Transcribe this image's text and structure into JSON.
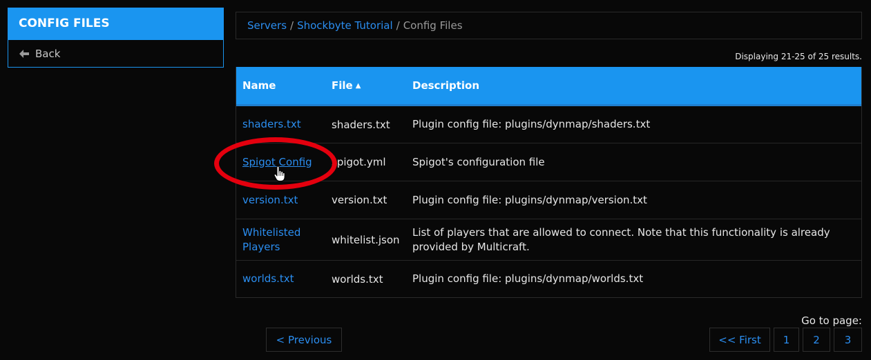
{
  "sidebar": {
    "title": "CONFIG FILES",
    "back_label": "Back"
  },
  "breadcrumb": {
    "items": [
      "Servers",
      "Shockbyte Tutorial"
    ],
    "current": "Config Files",
    "separator": "/"
  },
  "summary": "Displaying 21-25 of 25 results.",
  "table": {
    "headers": {
      "name": "Name",
      "file": "File",
      "description": "Description"
    },
    "sort_icon": "caret-up-icon",
    "rows": [
      {
        "name": "shaders.txt",
        "file": "shaders.txt",
        "description": "Plugin config file: plugins/dynmap/shaders.txt"
      },
      {
        "name": "Spigot Config",
        "file": "spigot.yml",
        "description": "Spigot's configuration file"
      },
      {
        "name": "version.txt",
        "file": "version.txt",
        "description": "Plugin config file: plugins/dynmap/version.txt"
      },
      {
        "name": "Whitelisted Players",
        "file": "whitelist.json",
        "description": "List of players that are allowed to connect. Note that this functionality is already provided by Multicraft."
      },
      {
        "name": "worlds.txt",
        "file": "worlds.txt",
        "description": "Plugin config file: plugins/dynmap/worlds.txt"
      }
    ]
  },
  "pagination": {
    "goto_label": "Go to page:",
    "previous": "< Previous",
    "first": "<< First",
    "pages": [
      "1",
      "2",
      "3"
    ]
  },
  "colors": {
    "accent": "#1a95f0",
    "link": "#2b8ef0",
    "highlight": "#e4000e",
    "background": "#080808"
  }
}
